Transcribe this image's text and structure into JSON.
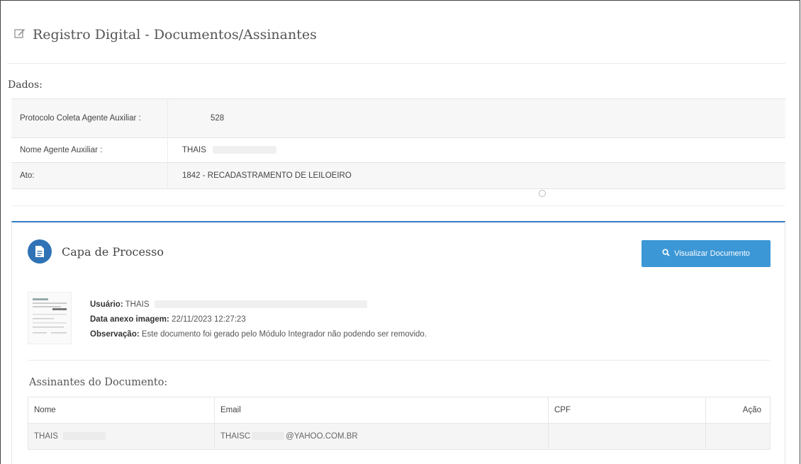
{
  "header": {
    "title": "Registro Digital - Documentos/Assinantes",
    "icon": "edit-icon"
  },
  "dados": {
    "label": "Dados:",
    "rows": [
      {
        "key": "Protocolo Coleta Agente Auxiliar :",
        "value": "528"
      },
      {
        "key": "Nome Agente Auxiliar :",
        "value": "THAIS"
      },
      {
        "key": "Ato:",
        "value": "1842 - RECADASTRAMENTO DE LEILOEIRO"
      }
    ]
  },
  "panel": {
    "title": "Capa de Processo",
    "icon": "document-icon",
    "button": {
      "label": "Visualizar Documento",
      "icon": "search-icon",
      "color": "#3c97d6"
    },
    "meta": {
      "usuario_label": "Usuário:",
      "usuario_value": "THAIS",
      "data_label": "Data anexo imagem:",
      "data_value": "22/11/2023 12:27:23",
      "obs_label": "Observação:",
      "obs_value": "Este documento foi gerado pelo Módulo Integrador não podendo ser removido."
    },
    "signers": {
      "title": "Assinantes do Documento:",
      "columns": [
        "Nome",
        "Email",
        "CPF",
        "Ação"
      ],
      "rows": [
        {
          "nome": "THAIS",
          "email": "THAISC",
          "email_domain": "@YAHOO.COM.BR",
          "cpf": "",
          "acao": ""
        }
      ]
    }
  },
  "colors": {
    "accent": "#2f7ec7",
    "button": "#3c97d6"
  }
}
